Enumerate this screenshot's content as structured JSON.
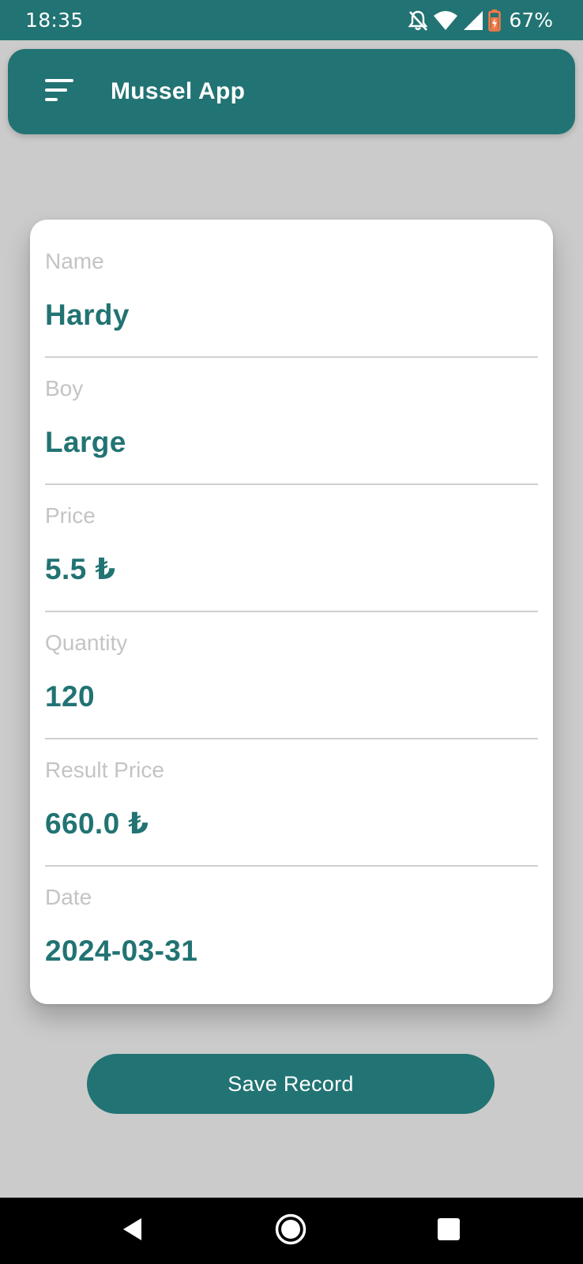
{
  "status_bar": {
    "time": "18:35",
    "battery": "67%",
    "icons": [
      "notifications-off-icon",
      "wifi-icon",
      "cell-signal-icon",
      "battery-charging-icon"
    ]
  },
  "app_bar": {
    "title": "Mussel App",
    "menu_icon": "menu-icon"
  },
  "record": {
    "fields": [
      {
        "label": "Name",
        "value": "Hardy"
      },
      {
        "label": "Boy",
        "value": "Large"
      },
      {
        "label": "Price",
        "value": "5.5 ₺"
      },
      {
        "label": "Quantity",
        "value": "120"
      },
      {
        "label": "Result Price",
        "value": "660.0 ₺"
      },
      {
        "label": "Date",
        "value": "2024-03-31"
      }
    ]
  },
  "actions": {
    "save_label": "Save Record"
  },
  "nav_bar": {
    "icons": [
      "back-icon",
      "home-icon",
      "recents-icon"
    ]
  },
  "colors": {
    "primary": "#227373",
    "background": "#cbcbcb",
    "card": "#ffffff",
    "label": "#c4c4c4",
    "divider": "#d0d0d0"
  }
}
